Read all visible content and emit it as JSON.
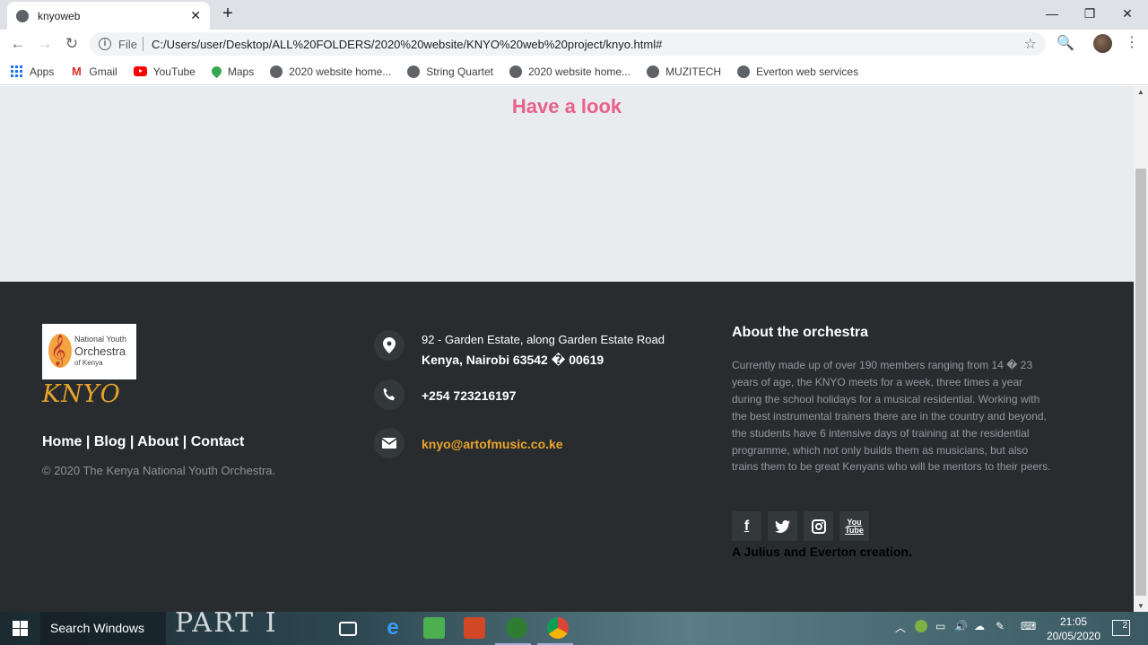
{
  "browser": {
    "tab_title": "knyoweb",
    "url_scheme": "File",
    "url": "C:/Users/user/Desktop/ALL%20FOLDERS/2020%20website/KNYO%20web%20project/knyo.html#"
  },
  "bookmarks": [
    {
      "label": "Apps",
      "icon": "apps-icon"
    },
    {
      "label": "Gmail",
      "icon": "gmail-icon"
    },
    {
      "label": "YouTube",
      "icon": "youtube-icon"
    },
    {
      "label": "Maps",
      "icon": "maps-icon"
    },
    {
      "label": "2020 website home...",
      "icon": "globe-icon"
    },
    {
      "label": "String Quartet",
      "icon": "globe-icon"
    },
    {
      "label": "2020 website home...",
      "icon": "globe-icon"
    },
    {
      "label": "MUZITECH",
      "icon": "globe-icon"
    },
    {
      "label": "Everton web services",
      "icon": "globe-icon"
    }
  ],
  "page": {
    "look_heading": "Have a look",
    "logo": {
      "line1": "National Youth",
      "line2": "Orchestra",
      "line3": "of Kenya"
    },
    "brand": "KNYO",
    "footer_links": [
      "Home",
      "Blog",
      "About",
      "Contact"
    ],
    "copyright": "© 2020 The Kenya National Youth Orchestra.",
    "contact": {
      "address_line1": "92 - Garden Estate, along Garden Estate Road",
      "address_line2": "Kenya, Nairobi 63542 � 00619",
      "phone": "+254 723216197",
      "email": "knyo@artofmusic.co.ke"
    },
    "about": {
      "title": "About the orchestra",
      "text": "Currently made up of over 190 members ranging from 14 � 23 years of age, the KNYO meets for a week, three times a year during the school holidays for a musical residential. Working with the best instrumental trainers there are in the country and beyond, the students have 6 intensive days of training at the residential programme, which not only builds them as musicians, but also trains them to be great Kenyans who will be mentors to their peers.",
      "credit": "A Julius and Everton creation."
    },
    "social": [
      {
        "label": "f",
        "icon": "facebook-icon"
      },
      {
        "label": "🐦",
        "icon": "twitter-icon"
      },
      {
        "label": "◙",
        "icon": "instagram-icon"
      },
      {
        "label": "You Tube",
        "icon": "youtube-icon"
      }
    ]
  },
  "taskbar": {
    "search_placeholder": "Search Windows",
    "wallpaper_text": "PART I",
    "time": "21:05",
    "date": "20/05/2020",
    "notifications": "2"
  }
}
